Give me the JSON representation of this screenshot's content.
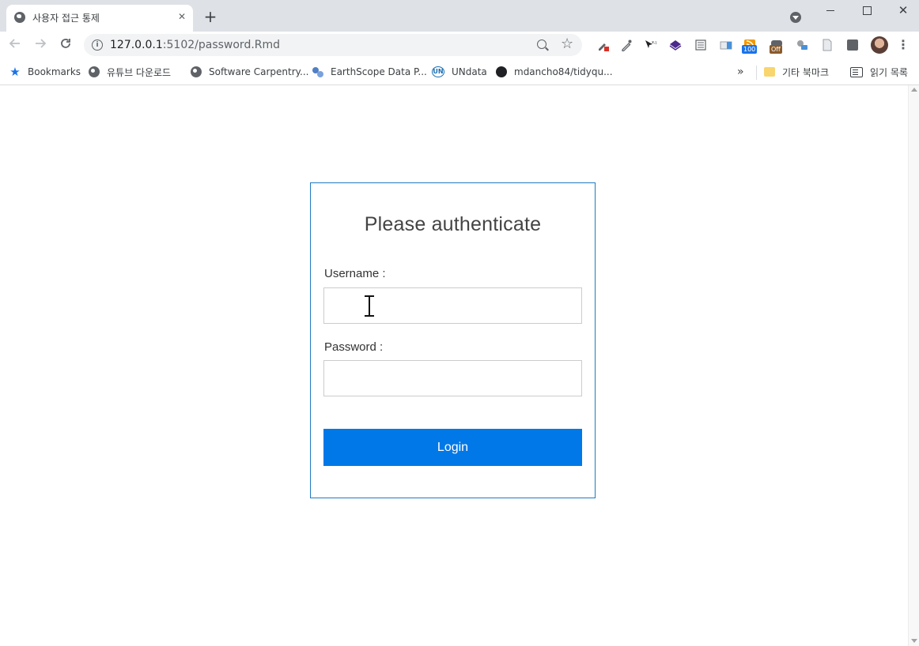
{
  "browser": {
    "tab": {
      "title": "사용자 접근 통제",
      "close_glyph": "✕"
    },
    "new_tab_glyph": "+",
    "window_controls": {
      "close_glyph": "✕"
    },
    "omnibox": {
      "url_host": "127.0.0.1",
      "url_rest": ":5102/password.Rmd"
    },
    "extensions": [
      {
        "name": "eyedropper-extension-icon"
      },
      {
        "name": "dropper-extension-icon"
      },
      {
        "name": "cursor-xy-extension-icon",
        "badge": ""
      },
      {
        "name": "layers-extension-icon"
      },
      {
        "name": "reader-extension-icon"
      },
      {
        "name": "box-extension-icon"
      },
      {
        "name": "rss-extension-icon",
        "badge": "100",
        "badge_color": "#1a73e8"
      },
      {
        "name": "toggle-extension-icon",
        "badge": "Off",
        "badge_color": "#8a5a2b"
      },
      {
        "name": "translate-extension-icon"
      },
      {
        "name": "page-extension-icon"
      }
    ],
    "bookmarks": {
      "items": [
        {
          "label": "Bookmarks",
          "icon": "star-icon"
        },
        {
          "label": "유튜브 다운로드",
          "icon": "globe-icon"
        },
        {
          "label": "Software Carpentry...",
          "icon": "globe-icon"
        },
        {
          "label": "EarthScope Data P...",
          "icon": "earthscope-icon"
        },
        {
          "label": "UNdata",
          "icon": "undata-icon"
        },
        {
          "label": "mdancho84/tidyqu...",
          "icon": "github-icon"
        }
      ],
      "overflow_glyph": "»",
      "other_bookmarks": "기타 북마크",
      "reading_list": "읽기 목록"
    }
  },
  "page": {
    "title": "Please authenticate",
    "username_label": "Username :",
    "username_value": "",
    "password_label": "Password :",
    "password_value": "",
    "login_label": "Login",
    "accent_color": "#0078e7",
    "panel_border_color": "#1f7bc1"
  }
}
